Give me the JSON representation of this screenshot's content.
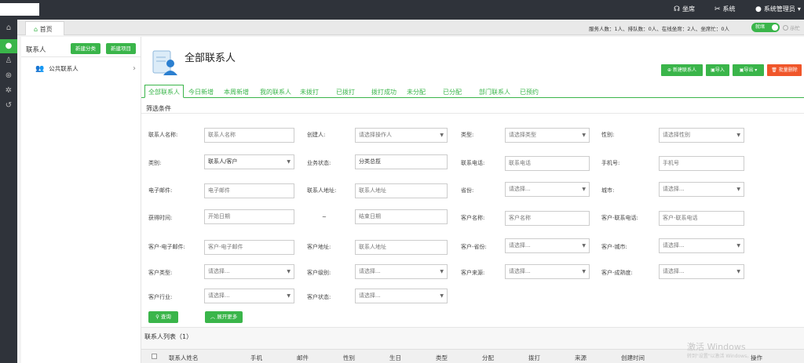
{
  "topbar": {
    "seat_label": "坐席",
    "system_label": "系统",
    "admin_label": "系统管理员"
  },
  "tabbar": {
    "home_label": "首页",
    "status_text": "服务人数：1人、排队数：0人、在线坐席：2人、坐席忙：0人",
    "toggle_on_label": "就绪",
    "toggle_off_label": "示忙"
  },
  "sidepanel": {
    "title": "联系人",
    "new_category_label": "新建分类",
    "new_item_label": "新建项目",
    "items": [
      {
        "label": "公共联系人"
      }
    ]
  },
  "main": {
    "title": "全部联系人",
    "actions": {
      "new_contact": "新建联系人",
      "import": "导入",
      "export": "导出",
      "batch_delete": "批量删除"
    },
    "tabs": [
      {
        "label": "全部联系人"
      },
      {
        "label": "今日新增"
      },
      {
        "label": "本周新增"
      },
      {
        "label": "我的联系人"
      },
      {
        "label": "未拨打"
      },
      {
        "label": "已拨打"
      },
      {
        "label": "拨打成功"
      },
      {
        "label": "未分配"
      },
      {
        "label": "已分配"
      },
      {
        "label": "部门联系人"
      },
      {
        "label": "已预约"
      }
    ],
    "filter_title": "筛选条件",
    "filters": {
      "contact_name": {
        "label": "联系人名称:",
        "placeholder": "联系人名称"
      },
      "creator": {
        "label": "创建人:",
        "placeholder": "请选择操作人"
      },
      "type": {
        "label": "类型:",
        "placeholder": "请选择类型"
      },
      "gender": {
        "label": "性别:",
        "placeholder": "请选择性别"
      },
      "category": {
        "label": "类别:",
        "value": "联系人/客户"
      },
      "biz_status": {
        "label": "业务状态:",
        "value": "分类总揽"
      },
      "phone": {
        "label": "联系电话:",
        "placeholder": "联系电话"
      },
      "mobile": {
        "label": "手机号:",
        "placeholder": "手机号"
      },
      "email": {
        "label": "电子邮件:",
        "placeholder": "电子邮件"
      },
      "address": {
        "label": "联系人地址:",
        "placeholder": "联系人地址"
      },
      "province": {
        "label": "省份:",
        "placeholder": "请选择..."
      },
      "city": {
        "label": "城市:",
        "placeholder": "请选择..."
      },
      "obtain_time": {
        "label": "获得时间:",
        "start_placeholder": "开始日期",
        "separator": "~",
        "end_placeholder": "结束日期"
      },
      "customer_name": {
        "label": "客户名称:",
        "placeholder": "客户名称"
      },
      "customer_phone": {
        "label": "客户-联系电话:",
        "placeholder": "客户-联系电话"
      },
      "customer_email": {
        "label": "客户-电子邮件:",
        "placeholder": "客户-电子邮件"
      },
      "customer_address": {
        "label": "客户地址:",
        "placeholder": "联系人地址"
      },
      "customer_province": {
        "label": "客户-省份:",
        "placeholder": "请选择..."
      },
      "customer_city": {
        "label": "客户-城市:",
        "placeholder": "请选择..."
      },
      "customer_type": {
        "label": "客户类型:",
        "placeholder": "请选择..."
      },
      "customer_level": {
        "label": "客户级别:",
        "placeholder": "请选择..."
      },
      "customer_source": {
        "label": "客户来源:",
        "placeholder": "请选择..."
      },
      "customer_maturity": {
        "label": "客户-成熟度:",
        "placeholder": "请选择..."
      },
      "customer_industry": {
        "label": "客户行业:",
        "placeholder": "请选择..."
      },
      "customer_status": {
        "label": "客户状态:",
        "placeholder": "请选择..."
      }
    },
    "query_label": "查询",
    "expand_label": "展开更多",
    "list_title": "联系人列表（1）",
    "columns": [
      "联系人姓名",
      "手机",
      "邮件",
      "性别",
      "生日",
      "类型",
      "分配",
      "拨打",
      "来源",
      "创建时间",
      "操作"
    ]
  },
  "watermark": {
    "line1": "激活 Windows",
    "line2": "转到\"设置\"以激活 Windows。"
  }
}
